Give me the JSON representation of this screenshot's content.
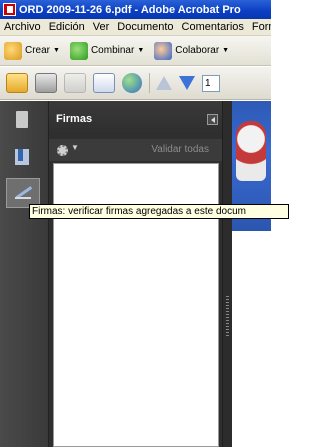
{
  "window": {
    "title": "ORD 2009-11-26 6.pdf - Adobe Acrobat Pro"
  },
  "menubar": {
    "items": [
      "Archivo",
      "Edición",
      "Ver",
      "Documento",
      "Comentarios",
      "Formu"
    ]
  },
  "toolbar1": {
    "crear": "Crear",
    "combinar": "Combinar",
    "colaborar": "Colaborar"
  },
  "toolbar2": {
    "page_number": "1"
  },
  "panel": {
    "title": "Firmas",
    "validate_all": "Validar todas"
  },
  "tooltip": {
    "text": "Firmas: verificar firmas agregadas a este docum"
  }
}
